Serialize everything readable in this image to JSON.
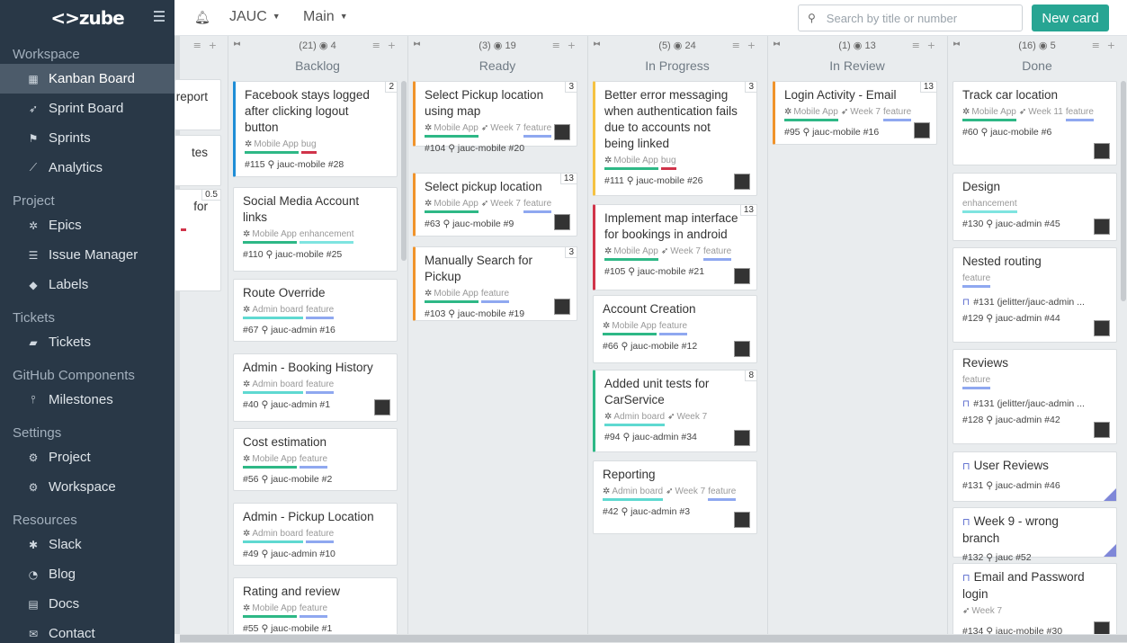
{
  "sidebar": {
    "logo": "zube",
    "sections": [
      {
        "title": "Workspace",
        "items": [
          {
            "label": "Kanban Board",
            "icon": "kanban-icon",
            "active": true
          },
          {
            "label": "Sprint Board",
            "icon": "rocket-icon"
          },
          {
            "label": "Sprints",
            "icon": "flag-icon"
          },
          {
            "label": "Analytics",
            "icon": "chart-icon"
          }
        ]
      },
      {
        "title": "Project",
        "items": [
          {
            "label": "Epics",
            "icon": "epic-icon"
          },
          {
            "label": "Issue Manager",
            "icon": "list-icon"
          },
          {
            "label": "Labels",
            "icon": "tag-icon"
          }
        ]
      },
      {
        "title": "Tickets",
        "items": [
          {
            "label": "Tickets",
            "icon": "ticket-icon"
          }
        ]
      },
      {
        "title": "GitHub Components",
        "items": [
          {
            "label": "Milestones",
            "icon": "milestone-icon"
          }
        ]
      },
      {
        "title": "Settings",
        "items": [
          {
            "label": "Project",
            "icon": "gear-icon"
          },
          {
            "label": "Workspace",
            "icon": "gear-icon"
          }
        ]
      },
      {
        "title": "Resources",
        "items": [
          {
            "label": "Slack",
            "icon": "slack-icon"
          },
          {
            "label": "Blog",
            "icon": "rss-icon"
          },
          {
            "label": "Docs",
            "icon": "docs-icon"
          },
          {
            "label": "Contact",
            "icon": "mail-icon"
          }
        ]
      }
    ]
  },
  "topbar": {
    "project": "JAUC",
    "board": "Main",
    "search_placeholder": "Search by title or number",
    "new_card": "New card"
  },
  "partial_column": {
    "cards": [
      {
        "text": "report"
      },
      {
        "text": "tes"
      },
      {
        "text": "for",
        "points": "0.5"
      }
    ]
  },
  "columns": [
    {
      "name": "Backlog",
      "count": "(21)",
      "points": "4",
      "cards": [
        {
          "title": "Facebook stays logged after clicking logout button",
          "points": "2",
          "border": "#1f8dd6",
          "tags": [
            {
              "label": "Mobile App",
              "color": "#2eb886"
            },
            {
              "label": "bug",
              "color": "#d0344a"
            }
          ],
          "number": "#115",
          "ref": "jauc-mobile #28"
        },
        {
          "title": "Social Media Account links",
          "tags": [
            {
              "label": "Mobile App",
              "color": "#2eb886"
            },
            {
              "label": "enhancement",
              "color": "#7fe4e0"
            }
          ],
          "number": "#110",
          "ref": "jauc-mobile #25"
        },
        {
          "title": "Route Override",
          "tags": [
            {
              "label": "Admin board",
              "color": "#5fd9d1"
            },
            {
              "label": "feature",
              "color": "#8fa8f0"
            }
          ],
          "number": "#67",
          "ref": "jauc-admin #16"
        },
        {
          "title": "Admin - Booking History",
          "tags": [
            {
              "label": "Admin board",
              "color": "#5fd9d1"
            },
            {
              "label": "feature",
              "color": "#8fa8f0"
            }
          ],
          "number": "#40",
          "ref": "jauc-admin #1",
          "avatar": true
        },
        {
          "title": "Cost estimation",
          "tags": [
            {
              "label": "Mobile App",
              "color": "#2eb886"
            },
            {
              "label": "feature",
              "color": "#8fa8f0"
            }
          ],
          "number": "#56",
          "ref": "jauc-mobile #2"
        },
        {
          "title": "Admin - Pickup Location",
          "tags": [
            {
              "label": "Admin board",
              "color": "#5fd9d1"
            },
            {
              "label": "feature",
              "color": "#8fa8f0"
            }
          ],
          "number": "#49",
          "ref": "jauc-admin #10"
        },
        {
          "title": "Rating and review",
          "tags": [
            {
              "label": "Mobile App",
              "color": "#2eb886"
            },
            {
              "label": "feature",
              "color": "#8fa8f0"
            }
          ],
          "number": "#55",
          "ref": "jauc-mobile #1"
        }
      ]
    },
    {
      "name": "Ready",
      "count": "(3)",
      "points": "19",
      "cards": [
        {
          "title": "Select Pickup location using map",
          "points": "3",
          "border": "#f0932b",
          "tags": [
            {
              "label": "Mobile App",
              "color": "#2eb886"
            },
            {
              "label": "Week 7",
              "color": ""
            },
            {
              "label": "feature",
              "color": "#8fa8f0"
            }
          ],
          "number": "#104",
          "ref": "jauc-mobile #20",
          "avatar": true
        },
        {
          "title": "Select pickup location",
          "points": "13",
          "border": "#f0932b",
          "tags": [
            {
              "label": "Mobile App",
              "color": "#2eb886"
            },
            {
              "label": "Week 7",
              "color": ""
            },
            {
              "label": "feature",
              "color": "#8fa8f0"
            }
          ],
          "number": "#63",
          "ref": "jauc-mobile #9",
          "avatar": true
        },
        {
          "title": "Manually Search for Pickup",
          "points": "3",
          "border": "#f0932b",
          "tags": [
            {
              "label": "Mobile App",
              "color": "#2eb886"
            },
            {
              "label": "feature",
              "color": "#8fa8f0"
            }
          ],
          "number": "#103",
          "ref": "jauc-mobile #19",
          "avatar": true
        }
      ]
    },
    {
      "name": "In Progress",
      "count": "(5)",
      "points": "24",
      "cards": [
        {
          "title": "Better error messaging when authentication fails due to accounts not being linked",
          "points": "3",
          "border": "#f5c242",
          "tags": [
            {
              "label": "Mobile App",
              "color": "#2eb886"
            },
            {
              "label": "bug",
              "color": "#d0344a"
            }
          ],
          "number": "#111",
          "ref": "jauc-mobile #26",
          "avatar": true
        },
        {
          "title": "Implement map interface for bookings in android",
          "points": "13",
          "border": "#d0344a",
          "tags": [
            {
              "label": "Mobile App",
              "color": "#2eb886"
            },
            {
              "label": "Week 7",
              "color": ""
            },
            {
              "label": "feature",
              "color": "#8fa8f0"
            }
          ],
          "number": "#105",
          "ref": "jauc-mobile #21",
          "avatar": true
        },
        {
          "title": "Account Creation",
          "tags": [
            {
              "label": "Mobile App",
              "color": "#2eb886"
            },
            {
              "label": "feature",
              "color": "#8fa8f0"
            }
          ],
          "number": "#66",
          "ref": "jauc-mobile #12",
          "avatar": true
        },
        {
          "title": "Added unit tests for CarService",
          "points": "8",
          "border": "#2eb886",
          "tags": [
            {
              "label": "Admin board",
              "color": "#5fd9d1"
            },
            {
              "label": "Week 7",
              "color": ""
            }
          ],
          "number": "#94",
          "ref": "jauc-admin #34",
          "avatar": true
        },
        {
          "title": "Reporting",
          "tags": [
            {
              "label": "Admin board",
              "color": "#5fd9d1"
            },
            {
              "label": "Week 7",
              "color": ""
            },
            {
              "label": "feature",
              "color": "#8fa8f0"
            }
          ],
          "number": "#42",
          "ref": "jauc-admin #3",
          "avatar": true
        }
      ]
    },
    {
      "name": "In Review",
      "count": "(1)",
      "points": "13",
      "cards": [
        {
          "title": "Login Activity - Email",
          "points": "13",
          "border": "#f0932b",
          "tags": [
            {
              "label": "Mobile App",
              "color": "#2eb886"
            },
            {
              "label": "Week 7",
              "color": ""
            },
            {
              "label": "feature",
              "color": "#8fa8f0"
            }
          ],
          "number": "#95",
          "ref": "jauc-mobile #16",
          "avatar": true
        }
      ]
    },
    {
      "name": "Done",
      "count": "(16)",
      "points": "5",
      "cards": [
        {
          "title": "Track car location",
          "tags": [
            {
              "label": "Mobile App",
              "color": "#2eb886"
            },
            {
              "label": "Week 11",
              "color": ""
            },
            {
              "label": "feature",
              "color": "#8fa8f0"
            }
          ],
          "number": "#60",
          "ref": "jauc-mobile #6",
          "avatar": true
        },
        {
          "title": "Design",
          "tags": [
            {
              "label": "enhancement",
              "color": "#7fe4e0"
            }
          ],
          "number": "#130",
          "ref": "jauc-admin #45",
          "avatar": true
        },
        {
          "title": "Nested routing",
          "tags": [
            {
              "label": "feature",
              "color": "#8fa8f0"
            }
          ],
          "pr": "#131 (jelitter/jauc-admin ...",
          "number": "#129",
          "ref": "jauc-admin #44",
          "avatar": true
        },
        {
          "title": "Reviews",
          "tags": [
            {
              "label": "feature",
              "color": "#8fa8f0"
            }
          ],
          "pr": "#131 (jelitter/jauc-admin ...",
          "number": "#128",
          "ref": "jauc-admin #42",
          "avatar": true
        },
        {
          "title": "User Reviews",
          "pr_title": true,
          "number": "#131",
          "ref": "jauc-admin #46",
          "corner": true
        },
        {
          "title": "Week 9 - wrong branch",
          "pr_title": true,
          "number": "#132",
          "ref": "jauc #52",
          "corner": true
        },
        {
          "title": "Email and Password login",
          "pr_title": true,
          "tags": [
            {
              "label": "Week 7",
              "color": ""
            }
          ],
          "number": "#134",
          "ref": "jauc-mobile #30",
          "avatar": true
        }
      ]
    }
  ]
}
